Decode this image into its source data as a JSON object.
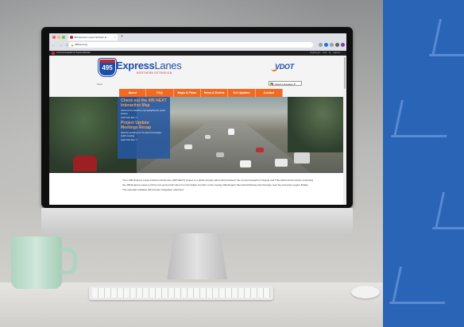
{
  "browser": {
    "tab_title": "495 Express Lanes Northern E...",
    "tab_close": "×",
    "new_tab": "+",
    "nav_icons": "← → C",
    "url": "495next.org",
    "lock": "🔒"
  },
  "cw_bar": {
    "text": "A Commonwealth of Virginia Website",
    "links": "Virginia.gov   Find an Agency"
  },
  "header": {
    "shield_number": "495",
    "logo_express": "Express",
    "logo_lanes": "Lanes",
    "logo_sub": "NORTHERN EXTENSION",
    "vdot": "VDOT",
    "home_link": "Home",
    "language": "Select Language ▼"
  },
  "nav": {
    "items": [
      "About",
      "FAQ",
      "Maps & Plans",
      "News & Events",
      "Get Updates",
      "Contact"
    ]
  },
  "hero": {
    "box_title_1": "Check out the 495 NEXT Interactive Map",
    "box_text_1": "Check out the interactive map highlighting the project features.",
    "box_link_1": "Learn more here >>",
    "box_title_2": "Project Update: Meetings Recap",
    "box_text_2": "Read the recording from the latest Ad-Campaign (public meeting).",
    "box_link_2": "Learn more here >>"
  },
  "body": {
    "paragraph": "The I-495 Express Lanes Northern Extension (495 NEXT) project is a public-private partnership between the Commonwealth of Virginia and Transurban that involves extending the 495 Express Lanes north by two-and-a-half miles from the Dulles Corridor to the George Washington Memorial Parkway interchanges near the American Legion Bridge. The important initiative will provide congestion relief and"
  },
  "colors": {
    "brand_blue": "#1e4ea8",
    "brand_orange": "#f26a21",
    "brand_red": "#c4262e",
    "panel_blue": "#2a64b7"
  }
}
